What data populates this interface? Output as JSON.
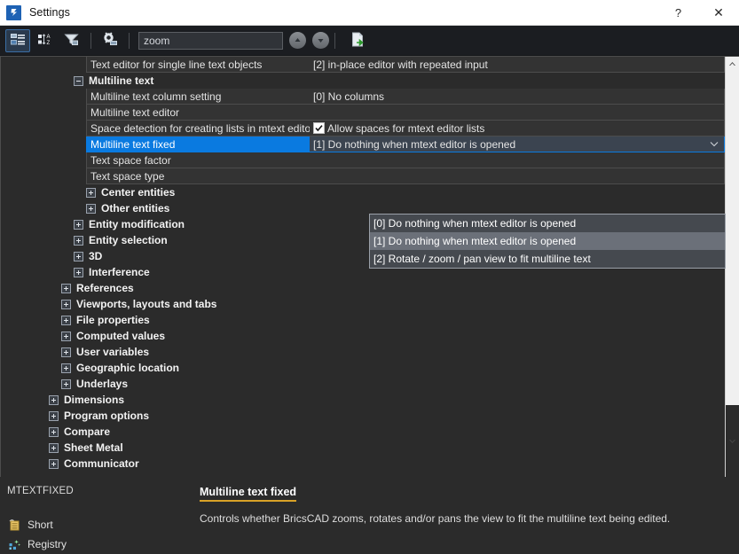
{
  "window": {
    "title": "Settings",
    "app_icon": "bricscad-logo-icon",
    "help_label": "?",
    "close_label": "✕"
  },
  "toolbar": {
    "buttons": [
      {
        "name": "tree-view-toggle",
        "icon": "tree-view-icon",
        "active": true
      },
      {
        "name": "alphabetical-sort-toggle",
        "icon": "sort-az-icon",
        "active": false
      },
      {
        "name": "filter-toggle",
        "icon": "funnel-filter-icon",
        "active": false
      },
      {
        "name": "settings-options",
        "icon": "gear-icon",
        "active": false
      }
    ],
    "search": {
      "value": "zoom",
      "placeholder": ""
    },
    "prev_label": "▲",
    "next_label": "▼",
    "export_label": "export-document-icon"
  },
  "grid": {
    "rows": [
      {
        "type": "item",
        "indent": 2,
        "label": "Text editor for single line text objects",
        "value": "[2] in-place editor with repeated input",
        "value_type": "text"
      },
      {
        "type": "group",
        "indent": 1,
        "label": "Multiline text",
        "expander": "minus"
      },
      {
        "type": "item",
        "indent": 2,
        "label": "Multiline text column setting",
        "value": "[0] No columns",
        "value_type": "text"
      },
      {
        "type": "item",
        "indent": 2,
        "label": "Multiline text editor",
        "value": "",
        "value_type": "text"
      },
      {
        "type": "item",
        "indent": 2,
        "label": "Space detection for creating lists in mtext editor",
        "value": "Allow spaces for mtext editor lists",
        "value_type": "checkbox",
        "checked": true
      },
      {
        "type": "item",
        "indent": 2,
        "label": "Multiline text fixed",
        "value": "[1] Do nothing when mtext editor is opened",
        "value_type": "combo",
        "selected": true
      },
      {
        "type": "item",
        "indent": 2,
        "label": "Text space factor",
        "value": "",
        "value_type": "text"
      },
      {
        "type": "item",
        "indent": 2,
        "label": "Text space type",
        "value": "",
        "value_type": "text"
      },
      {
        "type": "group",
        "indent": 2,
        "label": "Center entities",
        "expander": "plus"
      },
      {
        "type": "group",
        "indent": 2,
        "label": "Other entities",
        "expander": "plus"
      },
      {
        "type": "group",
        "indent": 1,
        "label": "Entity modification",
        "expander": "plus"
      },
      {
        "type": "group",
        "indent": 1,
        "label": "Entity selection",
        "expander": "plus"
      },
      {
        "type": "group",
        "indent": 1,
        "label": "3D",
        "expander": "plus"
      },
      {
        "type": "group",
        "indent": 1,
        "label": "Interference",
        "expander": "plus"
      },
      {
        "type": "group",
        "indent": 0,
        "label": "References",
        "expander": "plus"
      },
      {
        "type": "group",
        "indent": 0,
        "label": "Viewports, layouts and tabs",
        "expander": "plus"
      },
      {
        "type": "group",
        "indent": 0,
        "label": "File properties",
        "expander": "plus"
      },
      {
        "type": "group",
        "indent": 0,
        "label": "Computed values",
        "expander": "plus"
      },
      {
        "type": "group",
        "indent": 0,
        "label": "User variables",
        "expander": "plus"
      },
      {
        "type": "group",
        "indent": 0,
        "label": "Geographic location",
        "expander": "plus"
      },
      {
        "type": "group",
        "indent": 0,
        "label": "Underlays",
        "expander": "plus"
      },
      {
        "type": "group",
        "indent": -1,
        "label": "Dimensions",
        "expander": "plus"
      },
      {
        "type": "group",
        "indent": -1,
        "label": "Program options",
        "expander": "plus"
      },
      {
        "type": "group",
        "indent": -1,
        "label": "Compare",
        "expander": "plus"
      },
      {
        "type": "group",
        "indent": -1,
        "label": "Sheet Metal",
        "expander": "plus"
      },
      {
        "type": "group",
        "indent": -1,
        "label": "Communicator",
        "expander": "plus"
      }
    ]
  },
  "dropdown": {
    "open": true,
    "options": [
      {
        "label": "[0] Do nothing when mtext editor is opened",
        "highlighted": false
      },
      {
        "label": "[1] Do nothing when mtext editor is opened",
        "highlighted": true
      },
      {
        "label": "[2] Rotate / zoom / pan view to fit multiline text",
        "highlighted": false
      }
    ]
  },
  "details": {
    "variable_name": "MTEXTFIXED",
    "properties": [
      {
        "icon": "short-type-icon",
        "label": "Short"
      },
      {
        "icon": "registry-icon",
        "label": "Registry"
      }
    ],
    "title": "Multiline text fixed",
    "description": "Controls whether BricsCAD zooms, rotates and/or pans the view to fit the multiline text being edited.",
    "accent_color": "#d9a227"
  },
  "colors": {
    "selection_blue": "#0a7ae0",
    "toolbar_bg": "#1b1d21",
    "panel_bg": "#2b2b2b",
    "row_bg": "#333333"
  }
}
